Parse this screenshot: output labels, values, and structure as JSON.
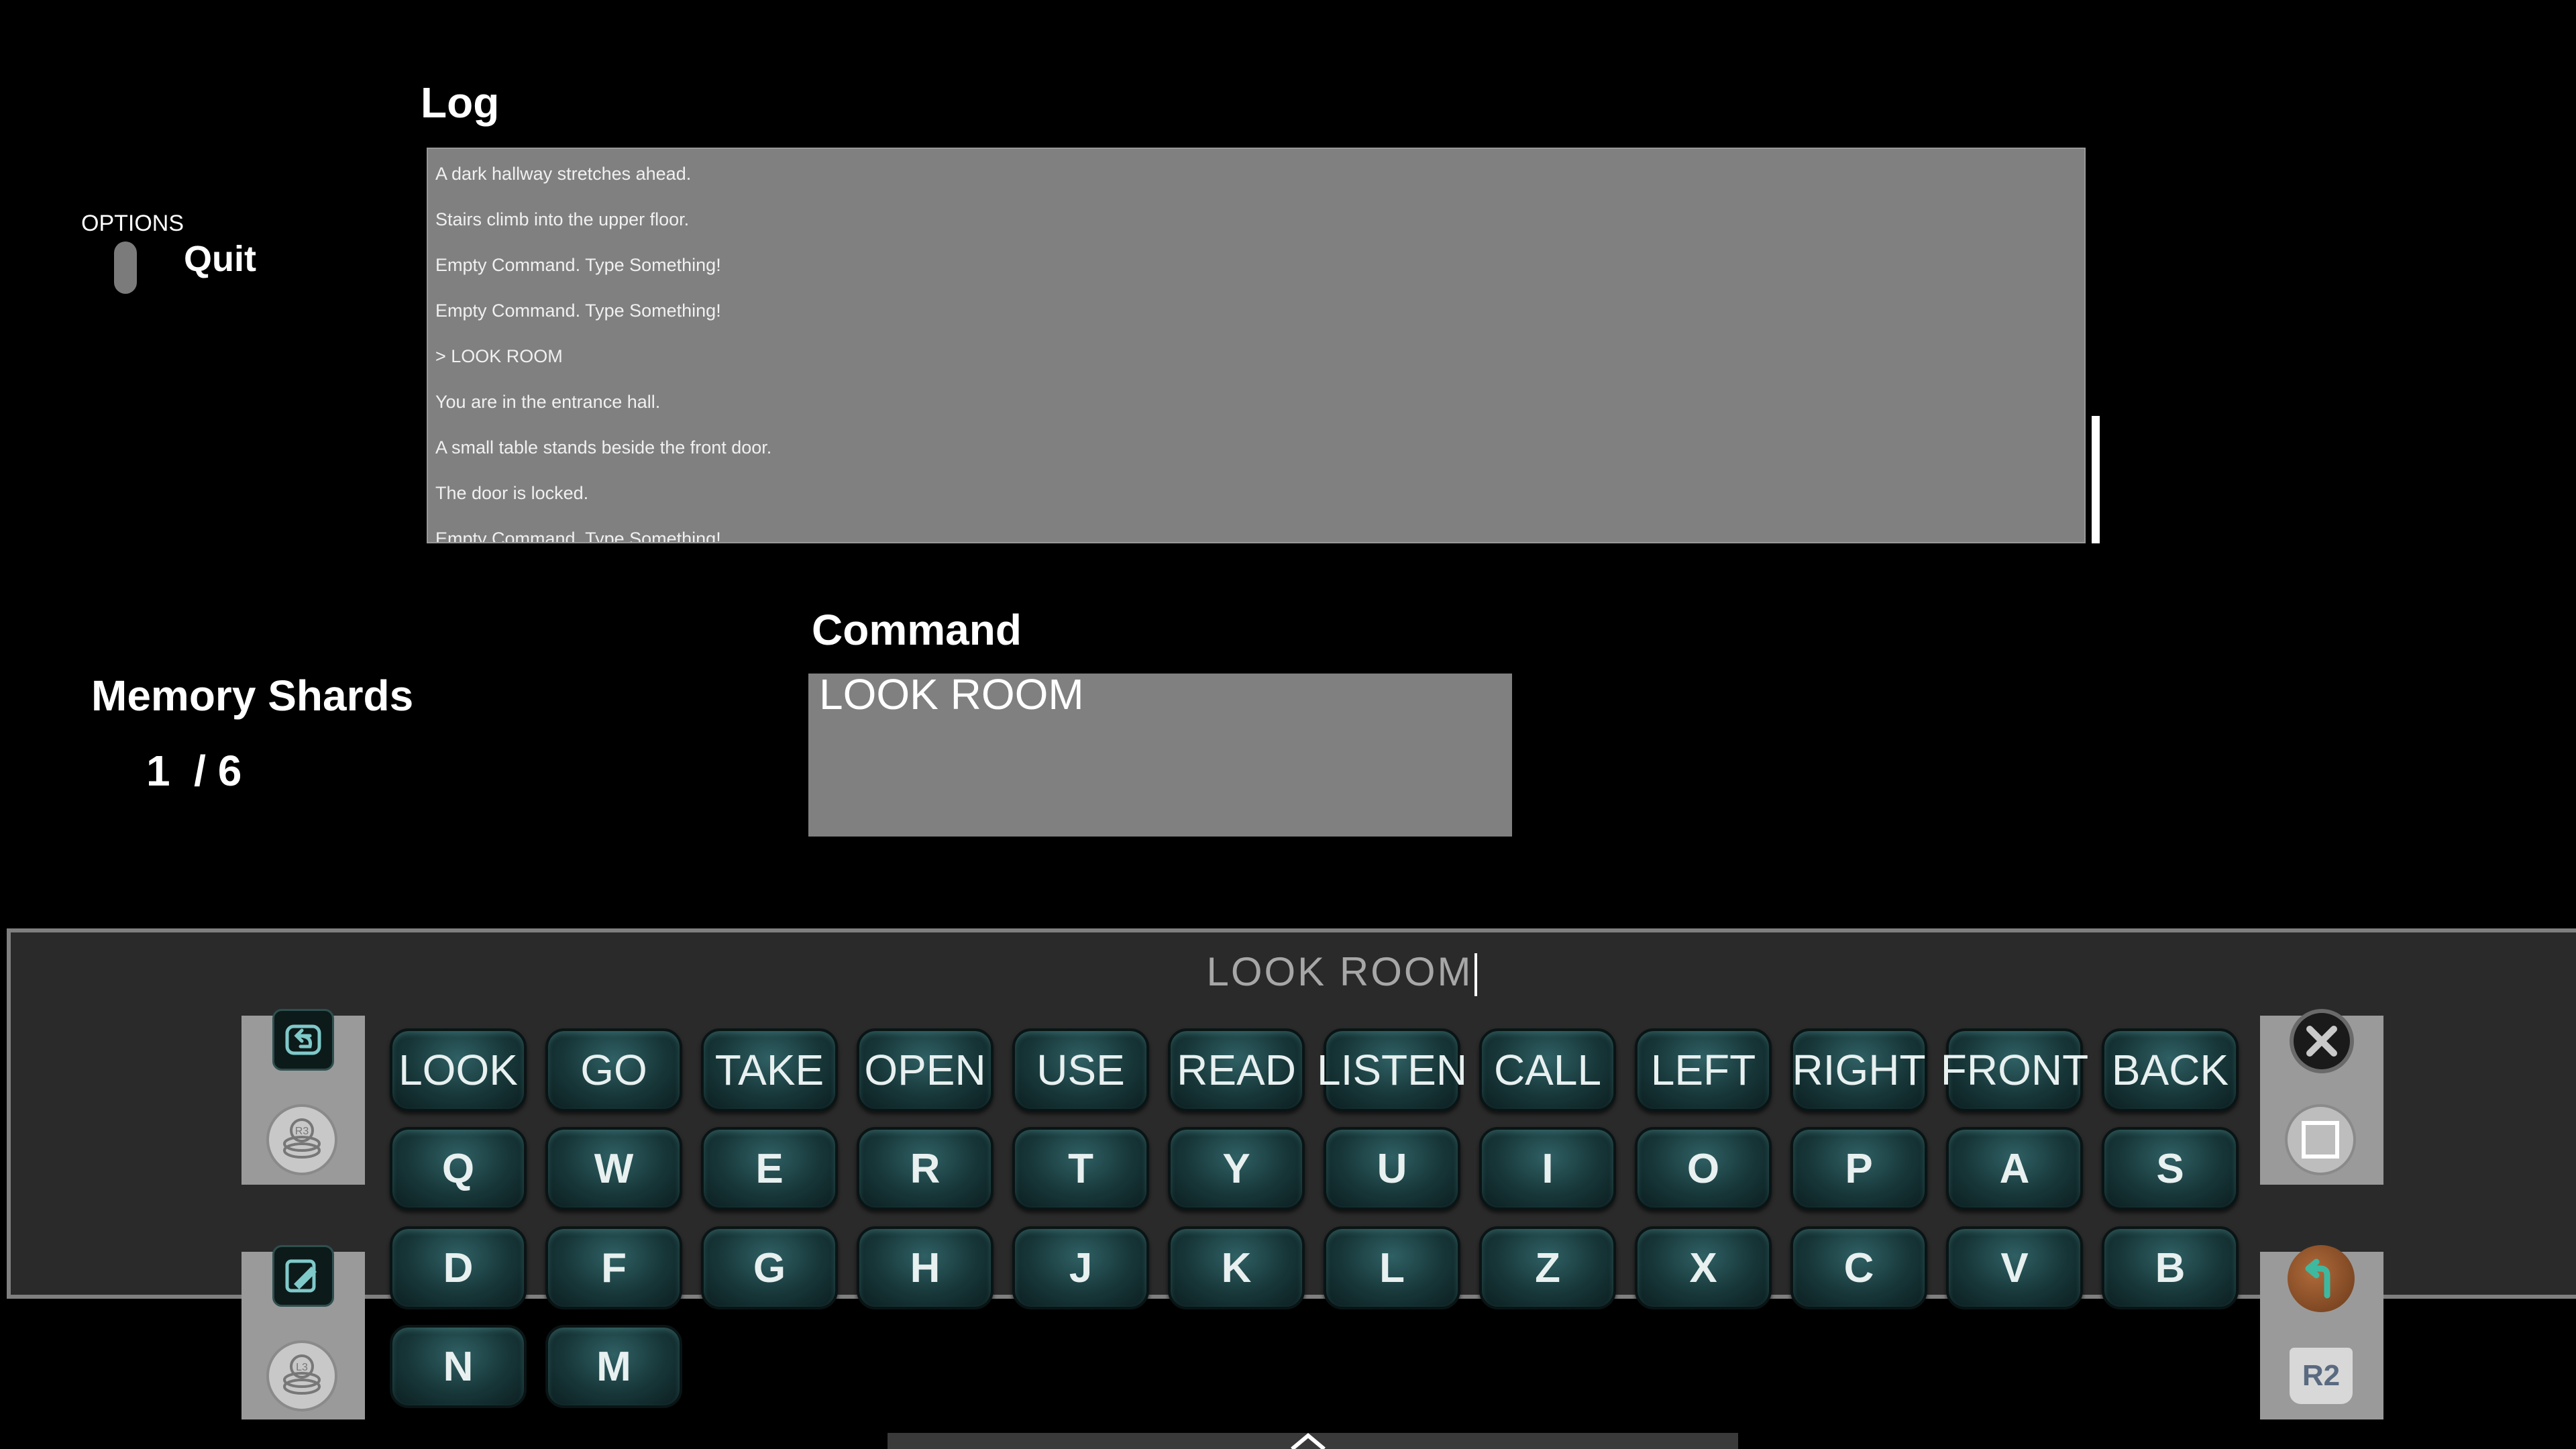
{
  "options": {
    "label": "OPTIONS",
    "quit_label": "Quit"
  },
  "log": {
    "title": "Log",
    "lines": [
      "A dark hallway stretches ahead.",
      "Stairs climb into the upper floor.",
      "Empty Command. Type Something!",
      "Empty Command. Type Something!",
      "> LOOK ROOM",
      "You are in the entrance hall.",
      "A small table stands beside the front door.",
      "The door is locked.",
      "Empty Command. Type Something!"
    ]
  },
  "shards": {
    "title": "Memory Shards",
    "value": "1  / 6"
  },
  "command": {
    "title": "Command",
    "value": "LOOK ROOM"
  },
  "keyboard": {
    "input_value": "LOOK ROOM",
    "rows": [
      [
        "LOOK",
        "GO",
        "TAKE",
        "OPEN",
        "USE",
        "READ",
        "LISTEN",
        "CALL",
        "LEFT",
        "RIGHT",
        "FRONT",
        "BACK"
      ],
      [
        "Q",
        "W",
        "E",
        "R",
        "T",
        "Y",
        "U",
        "I",
        "O",
        "P",
        "A",
        "S"
      ],
      [
        "D",
        "F",
        "G",
        "H",
        "J",
        "K",
        "L",
        "Z",
        "X",
        "C",
        "V",
        "B"
      ],
      [
        "N",
        "M"
      ]
    ],
    "left_icons": [
      "undo-icon",
      "r3-stick-icon",
      "edit-icon",
      "l3-stick-icon"
    ],
    "right_icons": [
      "close-x-icon",
      "square-button-icon",
      "back-arrow-icon",
      "r2-trigger-icon"
    ],
    "r3_label": "R3",
    "l3_label": "L3",
    "r2_label": "R2"
  }
}
